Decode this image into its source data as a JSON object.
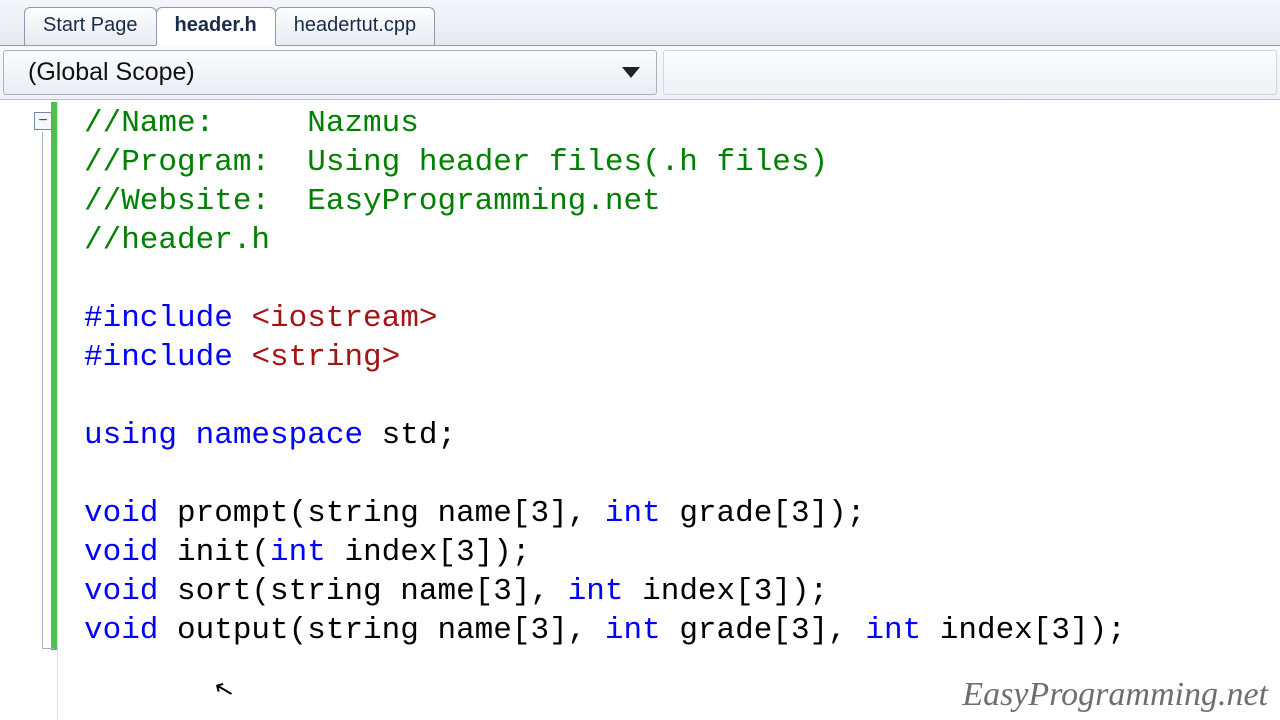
{
  "tabs": [
    {
      "label": "Start Page",
      "active": false
    },
    {
      "label": "header.h",
      "active": true
    },
    {
      "label": "headertut.cpp",
      "active": false
    }
  ],
  "scope": {
    "label": "(Global Scope)"
  },
  "fold": {
    "symbol": "−"
  },
  "code": {
    "l1": {
      "full": "//Name:     Nazmus"
    },
    "l2": {
      "full": "//Program:  Using header files(.h files)"
    },
    "l3": {
      "full": "//Website:  EasyProgramming.net"
    },
    "l4": {
      "full": "//header.h"
    },
    "l5": {
      "full": ""
    },
    "l6": {
      "pre": "#include ",
      "angle": "<iostream>"
    },
    "l7": {
      "pre": "#include ",
      "angle": "<string>"
    },
    "l8": {
      "full": ""
    },
    "l9": {
      "kw1": "using",
      "sp1": " ",
      "kw2": "namespace",
      "rest": " std;"
    },
    "l10": {
      "full": ""
    },
    "l11": {
      "kw": "void",
      "mid1": " prompt(string name[3], ",
      "kw2": "int",
      "mid2": " grade[3]);"
    },
    "l12": {
      "kw": "void",
      "mid1": " init(",
      "kw2": "int",
      "mid2": " index[3]);"
    },
    "l13": {
      "kw": "void",
      "mid1": " sort(string name[3], ",
      "kw2": "int",
      "mid2": " index[3]);"
    },
    "l14": {
      "kw": "void",
      "mid1": " output(string name[3], ",
      "kw2": "int",
      "mid2": " grade[3], ",
      "kw3": "int",
      "mid3": " index[3]);"
    }
  },
  "watermark": "EasyProgramming.net"
}
